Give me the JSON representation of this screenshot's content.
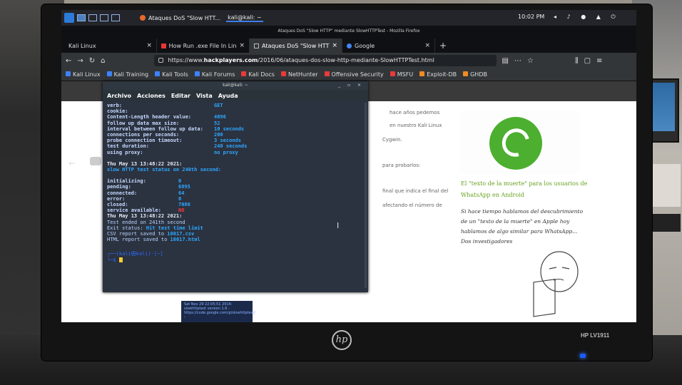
{
  "kali_panel": {
    "browser_task": "Ataques DoS \"Slow HTT...",
    "terminal_task": "kali@kali: ~",
    "clock": "10:02 PM"
  },
  "firefox": {
    "window_title": "Ataques DoS \"Slow HTTP\" mediante SlowHTTPTest - Mozilla Firefox",
    "tabs": [
      {
        "label": "Kali Linux",
        "active": false
      },
      {
        "label": "How Run .exe File In Lin",
        "active": false
      },
      {
        "label": "Ataques DoS \"Slow HTT",
        "active": true
      },
      {
        "label": "Google",
        "active": false
      }
    ],
    "url_prefix": "https://www.",
    "url_domain": "hackplayers.com",
    "url_path": "/2016/06/ataques-dos-slow-http-mediante-SlowHTTPTest.html",
    "bookmarks": [
      {
        "label": "Kali Linux",
        "color": "#3d83ff"
      },
      {
        "label": "Kali Training",
        "color": "#3d83ff"
      },
      {
        "label": "Kali Tools",
        "color": "#3d83ff"
      },
      {
        "label": "Kali Forums",
        "color": "#3d83ff"
      },
      {
        "label": "Kali Docs",
        "color": "#e83b3b"
      },
      {
        "label": "NetHunter",
        "color": "#e83b3b"
      },
      {
        "label": "Offensive Security",
        "color": "#e83b3b"
      },
      {
        "label": "MSFU",
        "color": "#e83b3b"
      },
      {
        "label": "Exploit-DB",
        "color": "#f08a24"
      },
      {
        "label": "GHDB",
        "color": "#f08a24"
      }
    ]
  },
  "page": {
    "para1": "hace años pedemos",
    "para2": "en nuestro Kali Linux",
    "para3": "Cygwin.",
    "para4": "para probarlos:",
    "para5": "final que indica el final del",
    "para6": "afectando el número de",
    "sidebar_title": "El \"texto de la muerte\" para los usuarios de WhatsApp en Android",
    "sidebar_text": "Si hace tiempo hablamos del descubrimiento de un \"texto de la muerte\" en Apple hoy hablamos de algo similar para WhatsApp... Dos investigadores",
    "embed_text": "Sat Nov 29 22:05:51 2014: slowhttptest version 1.6 - https://code.google.com/p/slowhttptest/ -"
  },
  "terminal": {
    "title": "kali@kali: ~",
    "menu": [
      "Archivo",
      "Acciones",
      "Editar",
      "Vista",
      "Ayuda"
    ],
    "config": [
      {
        "key": "verb:",
        "value": "GET"
      },
      {
        "key": "cookie:",
        "value": ""
      },
      {
        "key": "Content-Length header value:",
        "value": "4096"
      },
      {
        "key": "follow up data max size:",
        "value": "52"
      },
      {
        "key": "interval between follow up data:",
        "value": "10 seconds"
      },
      {
        "key": "connections per seconds:",
        "value": "200"
      },
      {
        "key": "probe connection timeout:",
        "value": "3 seconds"
      },
      {
        "key": "test duration:",
        "value": "240 seconds"
      },
      {
        "key": "using proxy:",
        "value": "no proxy"
      }
    ],
    "status_date": "Thu May 13 13:48:22 2021:",
    "status_line": "slow HTTP test status on 240th second:",
    "stats": [
      {
        "key": "initializing:",
        "value": "0"
      },
      {
        "key": "pending:",
        "value": "6895"
      },
      {
        "key": "connected:",
        "value": "64"
      },
      {
        "key": "error:",
        "value": "0"
      },
      {
        "key": "closed:",
        "value": "7080"
      },
      {
        "key": "service available:",
        "value": "NO"
      }
    ],
    "end_date": "Thu May 13 13:48:22 2021:",
    "test_ended": "Test ended on 241th second",
    "exit_label": "Exit status: ",
    "exit_value": "Hit test time limit",
    "csv_label": "CSV report saved to ",
    "csv_value": "10017.csv",
    "html_label": "HTML report saved to ",
    "html_value": "10017.html",
    "prompt": "(kali㉿kali)-[~]"
  },
  "monitor": {
    "brand": "hp",
    "model": "HP LV1911"
  }
}
